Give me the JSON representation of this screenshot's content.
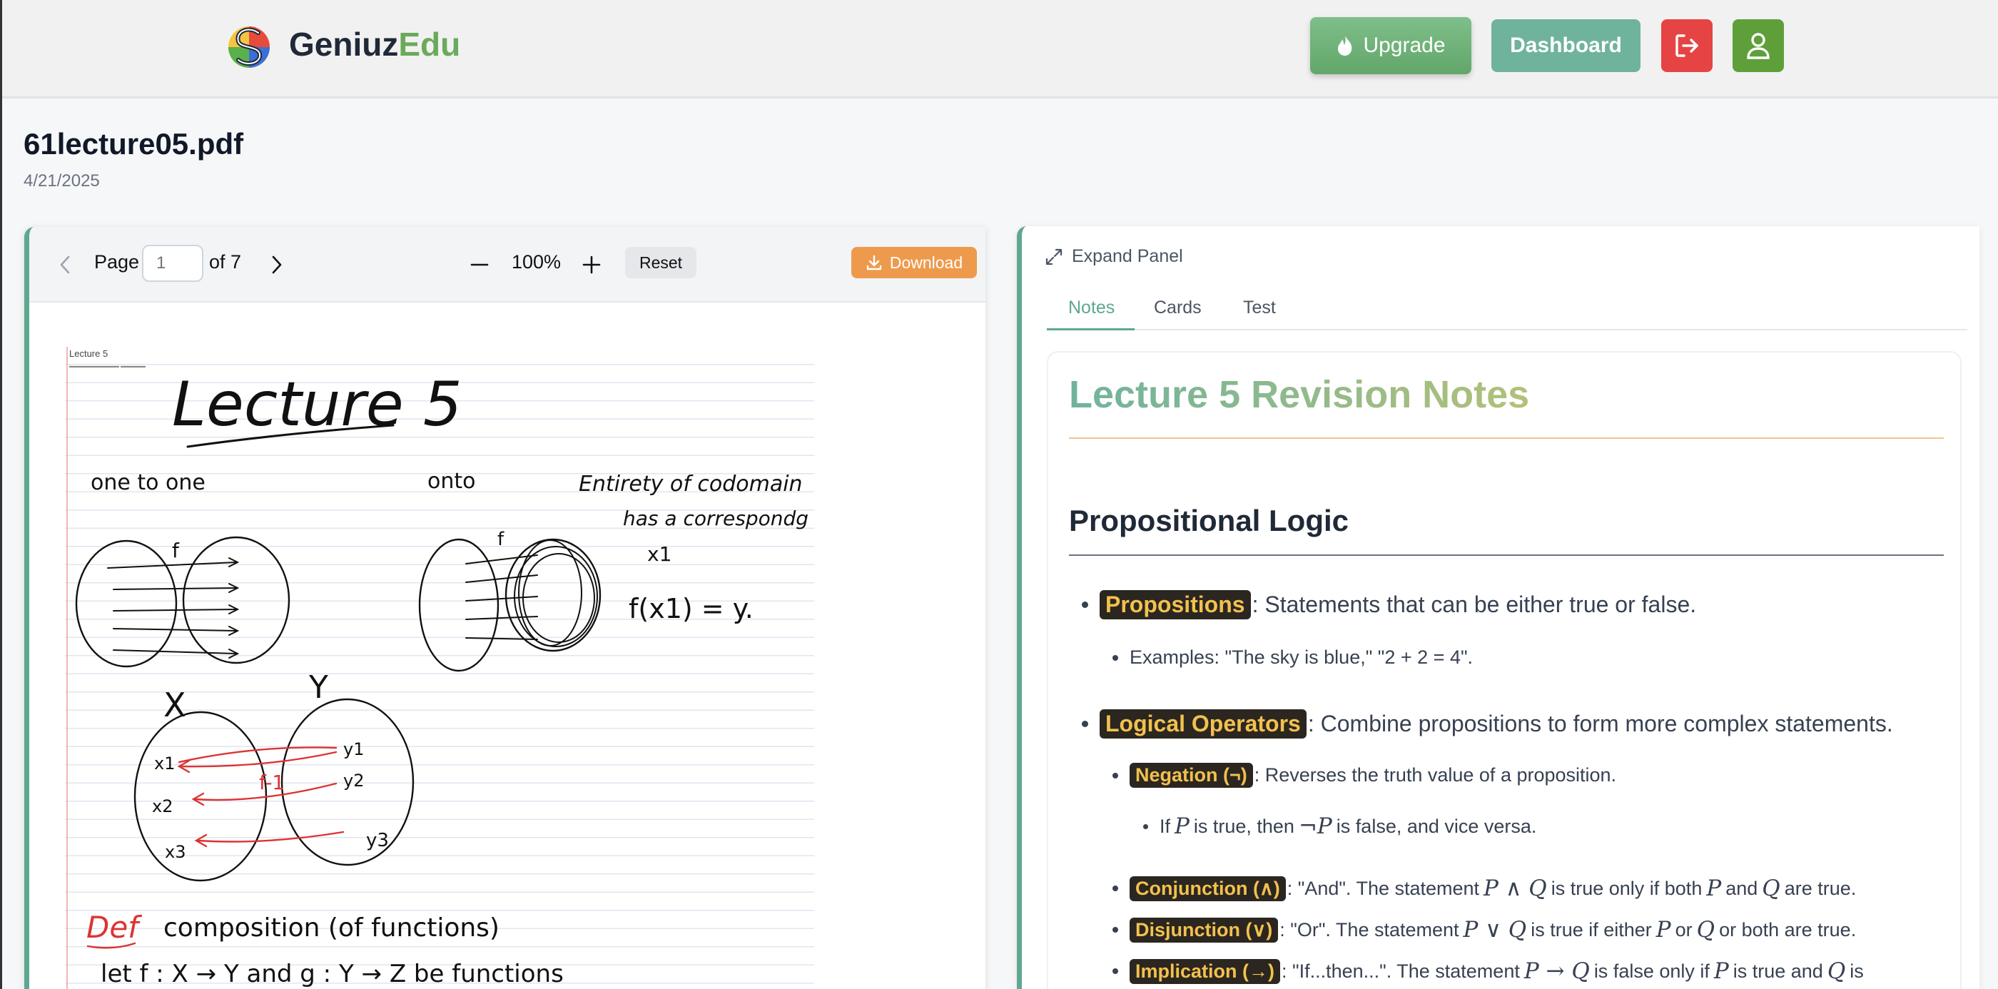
{
  "header": {
    "brand_part1": "Geniuz",
    "brand_part2": "Edu",
    "upgrade_label": "Upgrade",
    "dashboard_label": "Dashboard",
    "colors": {
      "brand_green": "#6aaa5a",
      "dashboard": "#6fb39d",
      "logout": "#e64444",
      "user": "#5e9f3a"
    },
    "icons": [
      "flame-icon",
      "logout-icon",
      "user-icon"
    ]
  },
  "file": {
    "name": "61lecture05.pdf",
    "date": "4/21/2025"
  },
  "pdf_viewer": {
    "page_label": "Page",
    "page_placeholder": "1",
    "page_of": "of 7",
    "zoom": "100%",
    "reset_label": "Reset",
    "download_label": "Download",
    "document": {
      "header_title": "Lecture 5",
      "handwritten": {
        "title": "Lecture 5",
        "one_to_one": "one to one",
        "onto": "onto",
        "codomain_note_1": "Entirety of codomain",
        "codomain_note_2": "has a correspondg",
        "x1": "x1",
        "fx": "f(x1) = y.",
        "set_x": "X",
        "set_y": "Y",
        "f": "f",
        "f_inverse": "f-1",
        "x1b": "x1",
        "x2": "x2",
        "x3": "x3",
        "y1": "y1",
        "y2": "y2",
        "y3": "y3",
        "def": "Def",
        "composition": "composition (of functions)",
        "let": "let f : X → Y and g : Y → Z be functions"
      }
    }
  },
  "notes_panel": {
    "expand_label": "Expand Panel",
    "tabs": [
      {
        "label": "Notes",
        "active": true
      },
      {
        "label": "Cards",
        "active": false
      },
      {
        "label": "Test",
        "active": false
      }
    ],
    "title": "Lecture 5 Revision Notes",
    "section": "Propositional Logic",
    "items": {
      "propositions_term": "Propositions",
      "propositions_text": ": Statements that can be either true or false.",
      "propositions_example": "Examples: \"The sky is blue,\" \"2 + 2 = 4\".",
      "operators_term": "Logical Operators",
      "operators_text": ": Combine propositions to form more complex statements.",
      "negation_term": "Negation (¬)",
      "negation_text": ": Reverses the truth value of a proposition.",
      "negation_example_1": "If",
      "negation_example_2": "is true, then",
      "negation_example_3": "is false, and vice versa.",
      "conjunction_term": "Conjunction (∧)",
      "conjunction_text_1": ": \"And\". The statement",
      "conjunction_text_2": "is true only if both",
      "conjunction_text_3": "and",
      "conjunction_text_4": "are true.",
      "disjunction_term": "Disjunction (∨)",
      "disjunction_text_1": ": \"Or\". The statement",
      "disjunction_text_2": "is true if either",
      "disjunction_text_3": "or",
      "disjunction_text_4": "or both are true.",
      "implication_term": "Implication (→)",
      "implication_text_1": ": \"If...then...\". The statement",
      "implication_text_2": "is false only if",
      "implication_text_3": "is true and",
      "implication_text_4": "is",
      "math": {
        "P": "P",
        "notP": "¬P",
        "PandQ": "P ∧ Q",
        "PorQ": "P ∨ Q",
        "PimpQ": "P → Q",
        "Q": "Q"
      }
    }
  }
}
